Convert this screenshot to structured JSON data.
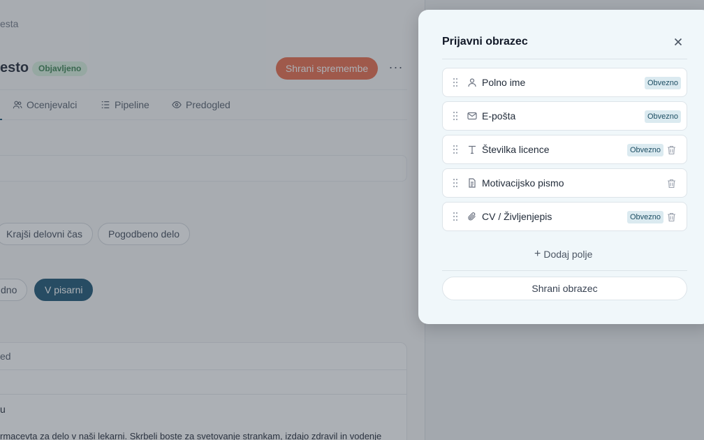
{
  "background": {
    "breadcrumb": "esta",
    "title": "esto",
    "status_badge": "Objavljeno",
    "save_changes": "Shrani spremembe",
    "more": "···",
    "tabs": [
      {
        "label": "Ocenjevalci",
        "icon": "users-icon"
      },
      {
        "label": "Pipeline",
        "icon": "list-icon"
      },
      {
        "label": "Predogled",
        "icon": "eye-icon"
      }
    ],
    "employment_pills": [
      "Krajši delovni čas",
      "Pogodbeno delo"
    ],
    "location_pills": [
      "dno",
      "V pisarni"
    ],
    "card_header": "ed",
    "card_row": "u",
    "card_text": "rmacevta za delo v naši lekarni. Skrbeli boste za svetovanje strankam, izdajo zdravil in vodenje"
  },
  "panel": {
    "title": "Prijavni obrazec",
    "fields": [
      {
        "label": "Polno ime",
        "icon": "user-icon",
        "required": "Obvezno",
        "deletable": false
      },
      {
        "label": "E-pošta",
        "icon": "mail-icon",
        "required": "Obvezno",
        "deletable": false
      },
      {
        "label": "Številka licence",
        "icon": "text-icon",
        "required": "Obvezno",
        "deletable": true
      },
      {
        "label": "Motivacijsko pismo",
        "icon": "document-icon",
        "required": "",
        "deletable": true
      },
      {
        "label": "CV / Življenjepis",
        "icon": "paperclip-icon",
        "required": "Obvezno",
        "deletable": true
      }
    ],
    "add_field": "Dodaj polje",
    "save_form": "Shrani obrazec"
  },
  "colors": {
    "accent_orange": "#e8613f",
    "primary_dark": "#0e4a6b",
    "published_green": "#2f7a45"
  }
}
